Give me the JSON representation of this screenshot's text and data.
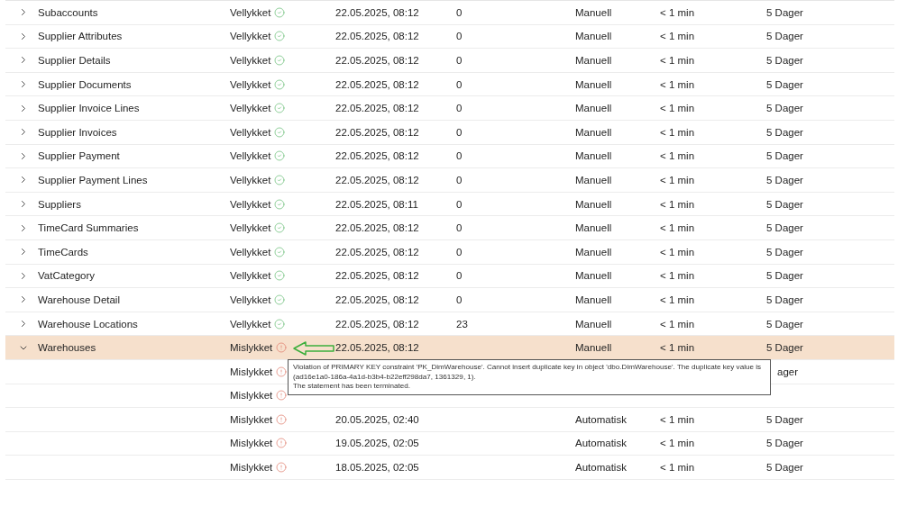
{
  "table": {
    "rows": [
      {
        "name": "Subaccounts",
        "status": "Vellykket",
        "kind": "success",
        "date": "22.05.2025, 08:12",
        "count": "0",
        "trigger": "Manuell",
        "duration": "< 1 min",
        "retention": "5 Dager",
        "expanded": false,
        "selected": false
      },
      {
        "name": "Supplier Attributes",
        "status": "Vellykket",
        "kind": "success",
        "date": "22.05.2025, 08:12",
        "count": "0",
        "trigger": "Manuell",
        "duration": "< 1 min",
        "retention": "5 Dager",
        "expanded": false,
        "selected": false
      },
      {
        "name": "Supplier Details",
        "status": "Vellykket",
        "kind": "success",
        "date": "22.05.2025, 08:12",
        "count": "0",
        "trigger": "Manuell",
        "duration": "< 1 min",
        "retention": "5 Dager",
        "expanded": false,
        "selected": false
      },
      {
        "name": "Supplier Documents",
        "status": "Vellykket",
        "kind": "success",
        "date": "22.05.2025, 08:12",
        "count": "0",
        "trigger": "Manuell",
        "duration": "< 1 min",
        "retention": "5 Dager",
        "expanded": false,
        "selected": false
      },
      {
        "name": "Supplier Invoice Lines",
        "status": "Vellykket",
        "kind": "success",
        "date": "22.05.2025, 08:12",
        "count": "0",
        "trigger": "Manuell",
        "duration": "< 1 min",
        "retention": "5 Dager",
        "expanded": false,
        "selected": false
      },
      {
        "name": "Supplier Invoices",
        "status": "Vellykket",
        "kind": "success",
        "date": "22.05.2025, 08:12",
        "count": "0",
        "trigger": "Manuell",
        "duration": "< 1 min",
        "retention": "5 Dager",
        "expanded": false,
        "selected": false
      },
      {
        "name": "Supplier Payment",
        "status": "Vellykket",
        "kind": "success",
        "date": "22.05.2025, 08:12",
        "count": "0",
        "trigger": "Manuell",
        "duration": "< 1 min",
        "retention": "5 Dager",
        "expanded": false,
        "selected": false
      },
      {
        "name": "Supplier Payment Lines",
        "status": "Vellykket",
        "kind": "success",
        "date": "22.05.2025, 08:12",
        "count": "0",
        "trigger": "Manuell",
        "duration": "< 1 min",
        "retention": "5 Dager",
        "expanded": false,
        "selected": false
      },
      {
        "name": "Suppliers",
        "status": "Vellykket",
        "kind": "success",
        "date": "22.05.2025, 08:11",
        "count": "0",
        "trigger": "Manuell",
        "duration": "< 1 min",
        "retention": "5 Dager",
        "expanded": false,
        "selected": false
      },
      {
        "name": "TimeCard Summaries",
        "status": "Vellykket",
        "kind": "success",
        "date": "22.05.2025, 08:12",
        "count": "0",
        "trigger": "Manuell",
        "duration": "< 1 min",
        "retention": "5 Dager",
        "expanded": false,
        "selected": false
      },
      {
        "name": "TimeCards",
        "status": "Vellykket",
        "kind": "success",
        "date": "22.05.2025, 08:12",
        "count": "0",
        "trigger": "Manuell",
        "duration": "< 1 min",
        "retention": "5 Dager",
        "expanded": false,
        "selected": false
      },
      {
        "name": "VatCategory",
        "status": "Vellykket",
        "kind": "success",
        "date": "22.05.2025, 08:12",
        "count": "0",
        "trigger": "Manuell",
        "duration": "< 1 min",
        "retention": "5 Dager",
        "expanded": false,
        "selected": false
      },
      {
        "name": "Warehouse Detail",
        "status": "Vellykket",
        "kind": "success",
        "date": "22.05.2025, 08:12",
        "count": "0",
        "trigger": "Manuell",
        "duration": "< 1 min",
        "retention": "5 Dager",
        "expanded": false,
        "selected": false
      },
      {
        "name": "Warehouse Locations",
        "status": "Vellykket",
        "kind": "success",
        "date": "22.05.2025, 08:12",
        "count": "23",
        "trigger": "Manuell",
        "duration": "< 1 min",
        "retention": "5 Dager",
        "expanded": false,
        "selected": false
      },
      {
        "name": "Warehouses",
        "status": "Mislykket",
        "kind": "failed",
        "date": "22.05.2025, 08:12",
        "trigger": "Manuell",
        "duration": "< 1 min",
        "retention": "5 Dager",
        "expanded": true,
        "selected": true,
        "children": [
          {
            "status": "Mislykket",
            "kind": "failed",
            "retention": "ager"
          },
          {
            "status": "Mislykket",
            "kind": "failed"
          },
          {
            "status": "Mislykket",
            "kind": "failed",
            "date": "20.05.2025, 02:40",
            "trigger": "Automatisk",
            "duration": "< 1 min",
            "retention": "5 Dager"
          },
          {
            "status": "Mislykket",
            "kind": "failed",
            "date": "19.05.2025, 02:05",
            "trigger": "Automatisk",
            "duration": "< 1 min",
            "retention": "5 Dager"
          },
          {
            "status": "Mislykket",
            "kind": "failed",
            "date": "18.05.2025, 02:05",
            "trigger": "Automatisk",
            "duration": "< 1 min",
            "retention": "5 Dager"
          }
        ]
      }
    ]
  },
  "tooltip": {
    "lines": [
      "Violation of PRIMARY KEY constraint 'PK_DimWarehouse'. Cannot insert duplicate key in object 'dbo.DimWarehouse'. The duplicate key value is",
      "(ad16e1a0-186a-4a1d-b3b4-b22eff298da7, 1361329, 1).",
      "The statement has been terminated."
    ]
  }
}
